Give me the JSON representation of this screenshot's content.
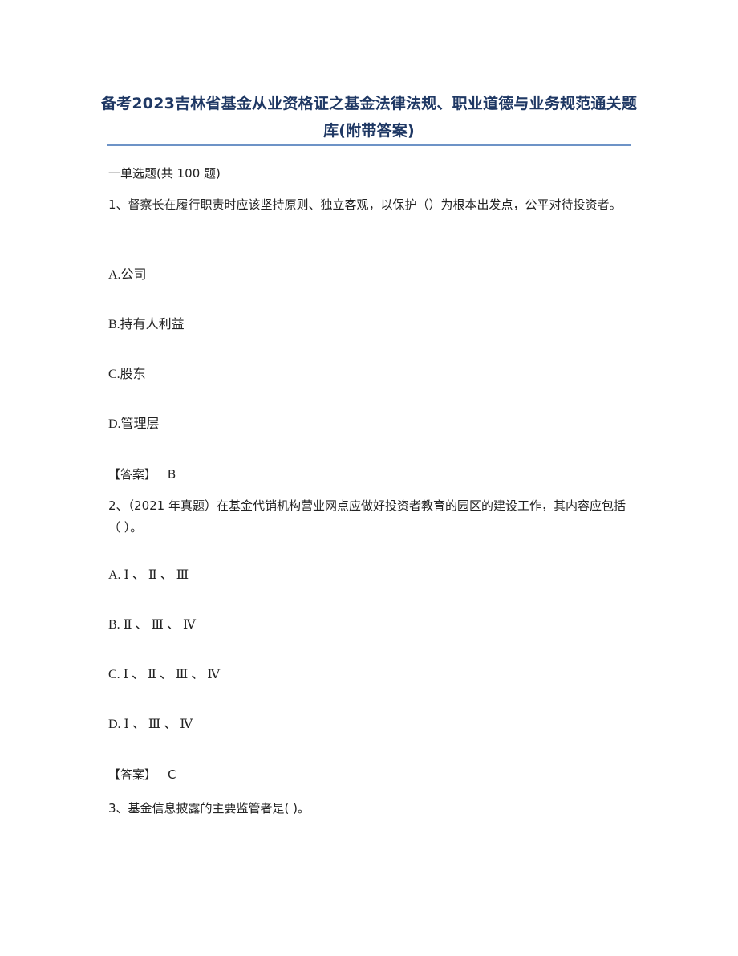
{
  "document": {
    "title": "备考2023吉林省基金从业资格证之基金法律法规、职业道德与业务规范通关题库(附带答案)",
    "section_heading": "一单选题(共 100 题)",
    "questions": [
      {
        "number": "1",
        "text": "1、督察长在履行职责时应该坚持原则、独立客观，以保护（）为根本出发点，公平对待投资者。",
        "options": [
          {
            "label": "A.公司"
          },
          {
            "label": "B.持有人利益"
          },
          {
            "label": "C.股东"
          },
          {
            "label": "D.管理层"
          }
        ],
        "answer_label": "【答案】",
        "answer_value": "B"
      },
      {
        "number": "2",
        "text": "2、（2021 年真题）在基金代销机构营业网点应做好投资者教育的园区的建设工作，其内容应包括（ ）。",
        "options": [
          {
            "label": "A. Ⅰ 、 Ⅱ 、 Ⅲ"
          },
          {
            "label": "B. Ⅱ 、 Ⅲ 、 Ⅳ"
          },
          {
            "label": "C. Ⅰ 、 Ⅱ 、 Ⅲ 、 Ⅳ"
          },
          {
            "label": "D. Ⅰ 、 Ⅲ 、 Ⅳ"
          }
        ],
        "answer_label": "【答案】",
        "answer_value": "C"
      },
      {
        "number": "3",
        "text": "3、基金信息披露的主要监管者是(    )。"
      }
    ]
  },
  "colors": {
    "title": "#1f3864",
    "divider": "#6d93c7",
    "body_text": "#222222"
  }
}
